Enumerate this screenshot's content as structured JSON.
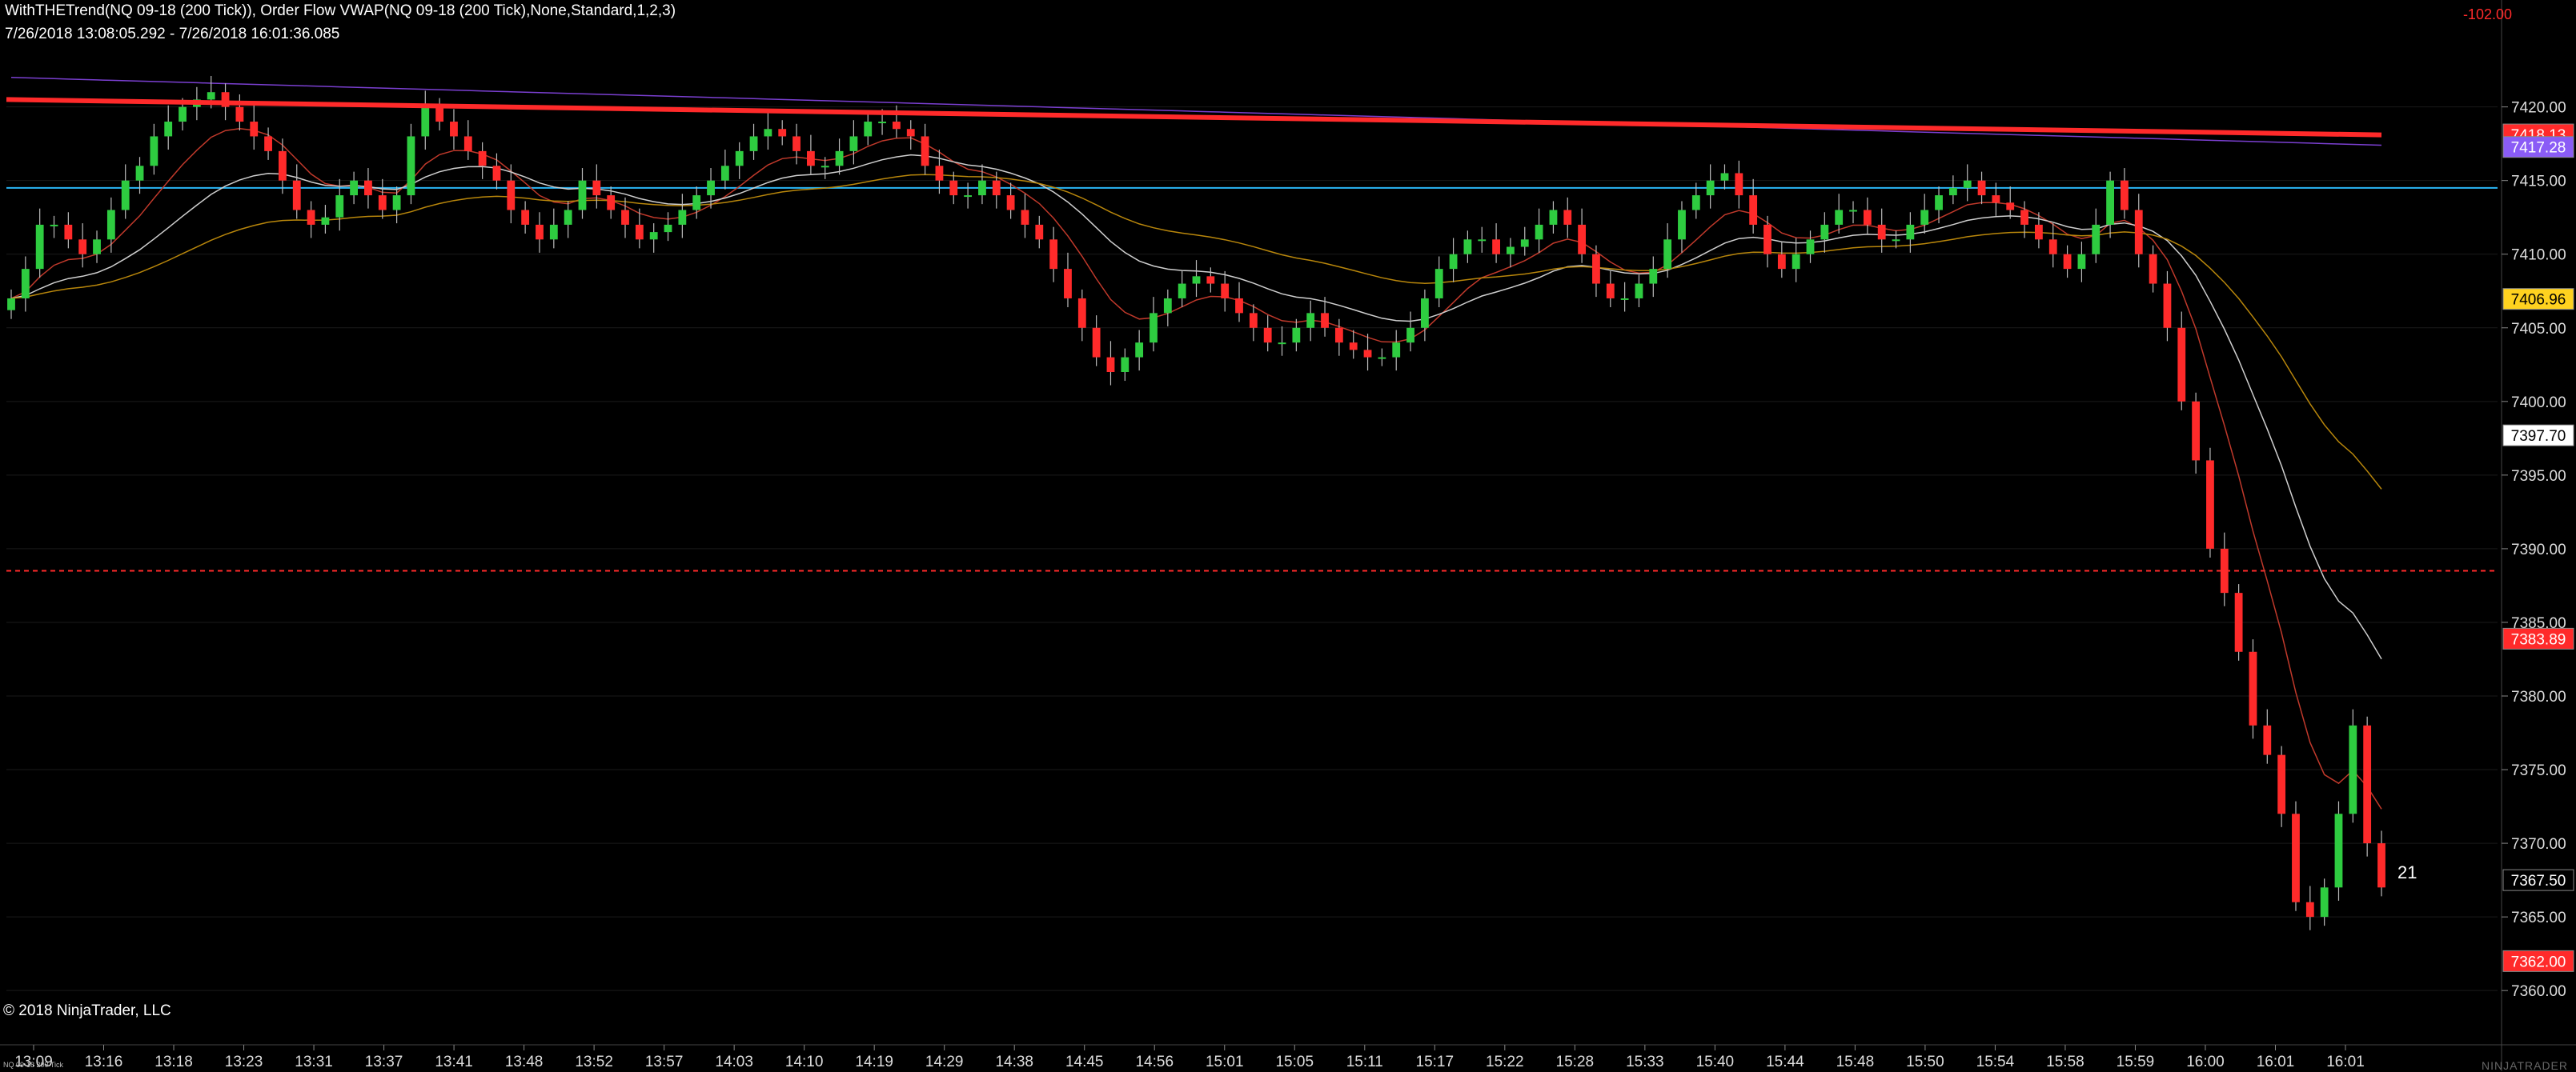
{
  "header": {
    "line1": "WithTHETrend(NQ 09-18 (200 Tick)), Order Flow VWAP(NQ 09-18 (200 Tick),None,Standard,1,2,3)",
    "line2": "7/26/2018 13:08:05.292 - 7/26/2018 16:01:36.085"
  },
  "pnl_value": "-102.00",
  "copyright": "© 2018 NinjaTrader, LLC",
  "footer_small": "NQ 09-18 200 Tick",
  "brand": "NINJATRADER",
  "colors": {
    "up": "#2ecc40",
    "down": "#ff2a2a",
    "grid": "#1a1a1a",
    "hline": "#29b6f6"
  },
  "chart_data": {
    "type": "candlestick",
    "instrument": "NQ 09-18 (200 Tick)",
    "ylim": [
      7358,
      7424
    ],
    "y_ticks": [
      7420,
      7415,
      7410,
      7405,
      7400,
      7395,
      7390,
      7385,
      7380,
      7375,
      7370,
      7365,
      7360
    ],
    "x_tick_labels": [
      "13:09",
      "13:16",
      "13:18",
      "13:23",
      "13:31",
      "13:37",
      "13:41",
      "13:48",
      "13:52",
      "13:57",
      "14:03",
      "14:10",
      "14:19",
      "14:29",
      "14:38",
      "14:45",
      "14:56",
      "15:01",
      "15:05",
      "15:11",
      "15:17",
      "15:22",
      "15:28",
      "15:33",
      "15:40",
      "15:44",
      "15:48",
      "15:50",
      "15:54",
      "15:58",
      "15:59",
      "16:00",
      "16:01",
      "16:01"
    ],
    "price_markers": [
      {
        "value": "7418.13",
        "color": "#ff2a2a"
      },
      {
        "value": "7417.28",
        "color": "#8a5cf6"
      },
      {
        "value": "7406.96",
        "color": "#ffd21f"
      },
      {
        "value": "7397.70",
        "color": "#ffffff"
      },
      {
        "value": "7383.89",
        "color": "#ff2a2a"
      },
      {
        "value": "7367.50",
        "color": "#000000"
      },
      {
        "value": "7362.00",
        "color": "#ff2a2a"
      }
    ],
    "horizontal_lines": [
      {
        "price": 7414.5,
        "color": "#29b6f6",
        "style": "solid"
      },
      {
        "price": 7388.5,
        "color": "#ff2a2a",
        "style": "dashed"
      }
    ],
    "trend_line": {
      "from": 7420.5,
      "to": 7418.1,
      "color": "#ff2a2a"
    },
    "bars_remaining": "21",
    "closes": [
      7407,
      7409,
      7412,
      7412,
      7411,
      7410,
      7411,
      7413,
      7415,
      7416,
      7418,
      7419,
      7420,
      7420.5,
      7421,
      7420,
      7419,
      7418,
      7417,
      7415,
      7413,
      7412,
      7412.5,
      7414,
      7415,
      7414,
      7413,
      7414,
      7418,
      7420,
      7419,
      7418,
      7417,
      7416,
      7415,
      7413,
      7412,
      7411,
      7412,
      7413,
      7415,
      7414,
      7413,
      7412,
      7411,
      7411.5,
      7412,
      7413,
      7414,
      7415,
      7416,
      7417,
      7418,
      7418.5,
      7418,
      7417,
      7416,
      7416,
      7417,
      7418,
      7419,
      7419,
      7418.5,
      7418,
      7416,
      7415,
      7414,
      7414,
      7415,
      7414,
      7413,
      7412,
      7411,
      7409,
      7407,
      7405,
      7403,
      7402,
      7403,
      7404,
      7406,
      7407,
      7408,
      7408.5,
      7408,
      7407,
      7406,
      7405,
      7404,
      7404,
      7405,
      7406,
      7405,
      7404,
      7403.5,
      7403,
      7403,
      7404,
      7405,
      7407,
      7409,
      7410,
      7411,
      7411,
      7410,
      7410.5,
      7411,
      7412,
      7413,
      7412,
      7410,
      7408,
      7407,
      7407,
      7408,
      7409,
      7411,
      7413,
      7414,
      7415,
      7415.5,
      7414,
      7412,
      7410,
      7409,
      7410,
      7411,
      7412,
      7413,
      7413,
      7412,
      7411,
      7411,
      7412,
      7413,
      7414,
      7414.5,
      7415,
      7414,
      7413.5,
      7413,
      7412,
      7411,
      7410,
      7409,
      7410,
      7412,
      7415,
      7413,
      7410,
      7408,
      7405,
      7400,
      7396,
      7390,
      7387,
      7383,
      7378,
      7376,
      7372,
      7366,
      7365,
      7367,
      7372,
      7378,
      7370,
      7367
    ]
  }
}
